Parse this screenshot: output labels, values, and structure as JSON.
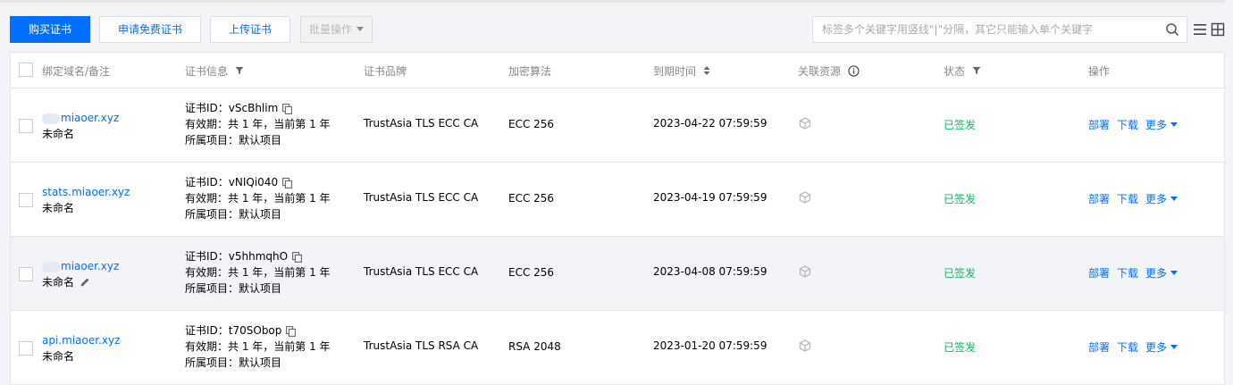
{
  "toolbar": {
    "buy_label": "购买证书",
    "apply_free_label": "申请免费证书",
    "upload_label": "上传证书",
    "batch_label": "批量操作",
    "search_placeholder": "标签多个关键字用竖线\"|\"分隔，其它只能输入单个关键字"
  },
  "table": {
    "headers": {
      "domain": "绑定域名/备注",
      "info": "证书信息",
      "brand": "证书品牌",
      "algo": "加密算法",
      "expiry": "到期时间",
      "resource": "关联资源",
      "status": "状态",
      "actions": "操作"
    },
    "rows": [
      {
        "domain": "miaoer.xyz",
        "domain_masked": true,
        "note": "未命名",
        "cert_id": "证书ID：vScBhlim",
        "validity": "有效期：共 1 年，当前第 1 年",
        "project": "所属项目：默认项目",
        "brand": "TrustAsia TLS ECC CA",
        "algo": "ECC 256",
        "expiry": "2023-04-22 07:59:59",
        "status": "已签发",
        "deploy": "部署",
        "download": "下载",
        "more": "更多"
      },
      {
        "domain": "stats.miaoer.xyz",
        "domain_masked": false,
        "note": "未命名",
        "cert_id": "证书ID：vNIQi040",
        "validity": "有效期：共 1 年，当前第 1 年",
        "project": "所属项目：默认项目",
        "brand": "TrustAsia TLS ECC CA",
        "algo": "ECC 256",
        "expiry": "2023-04-19 07:59:59",
        "status": "已签发",
        "deploy": "部署",
        "download": "下载",
        "more": "更多"
      },
      {
        "domain": "miaoer.xyz",
        "domain_masked": true,
        "note": "未命名",
        "cert_id": "证书ID：v5hhmqhO",
        "validity": "有效期：共 1 年，当前第 1 年",
        "project": "所属项目：默认项目",
        "brand": "TrustAsia TLS ECC CA",
        "algo": "ECC 256",
        "expiry": "2023-04-08 07:59:59",
        "status": "已签发",
        "deploy": "部署",
        "download": "下载",
        "more": "更多"
      },
      {
        "domain": "api.miaoer.xyz",
        "domain_masked": false,
        "note": "未命名",
        "cert_id": "证书ID：t70SObop",
        "validity": "有效期：共 1 年，当前第 1 年",
        "project": "所属项目：默认项目",
        "brand": "TrustAsia TLS RSA CA",
        "algo": "RSA 2048",
        "expiry": "2023-01-20 07:59:59",
        "status": "已签发",
        "deploy": "部署",
        "download": "下载",
        "more": "更多"
      }
    ]
  },
  "colors": {
    "primary": "#006eff",
    "success": "#0abf5b"
  },
  "icons": [
    "search-icon",
    "list-view-icon",
    "grid-view-icon",
    "filter-icon",
    "sort-icon",
    "info-icon",
    "copy-icon",
    "cube-icon",
    "edit-icon",
    "caret-down-icon"
  ]
}
